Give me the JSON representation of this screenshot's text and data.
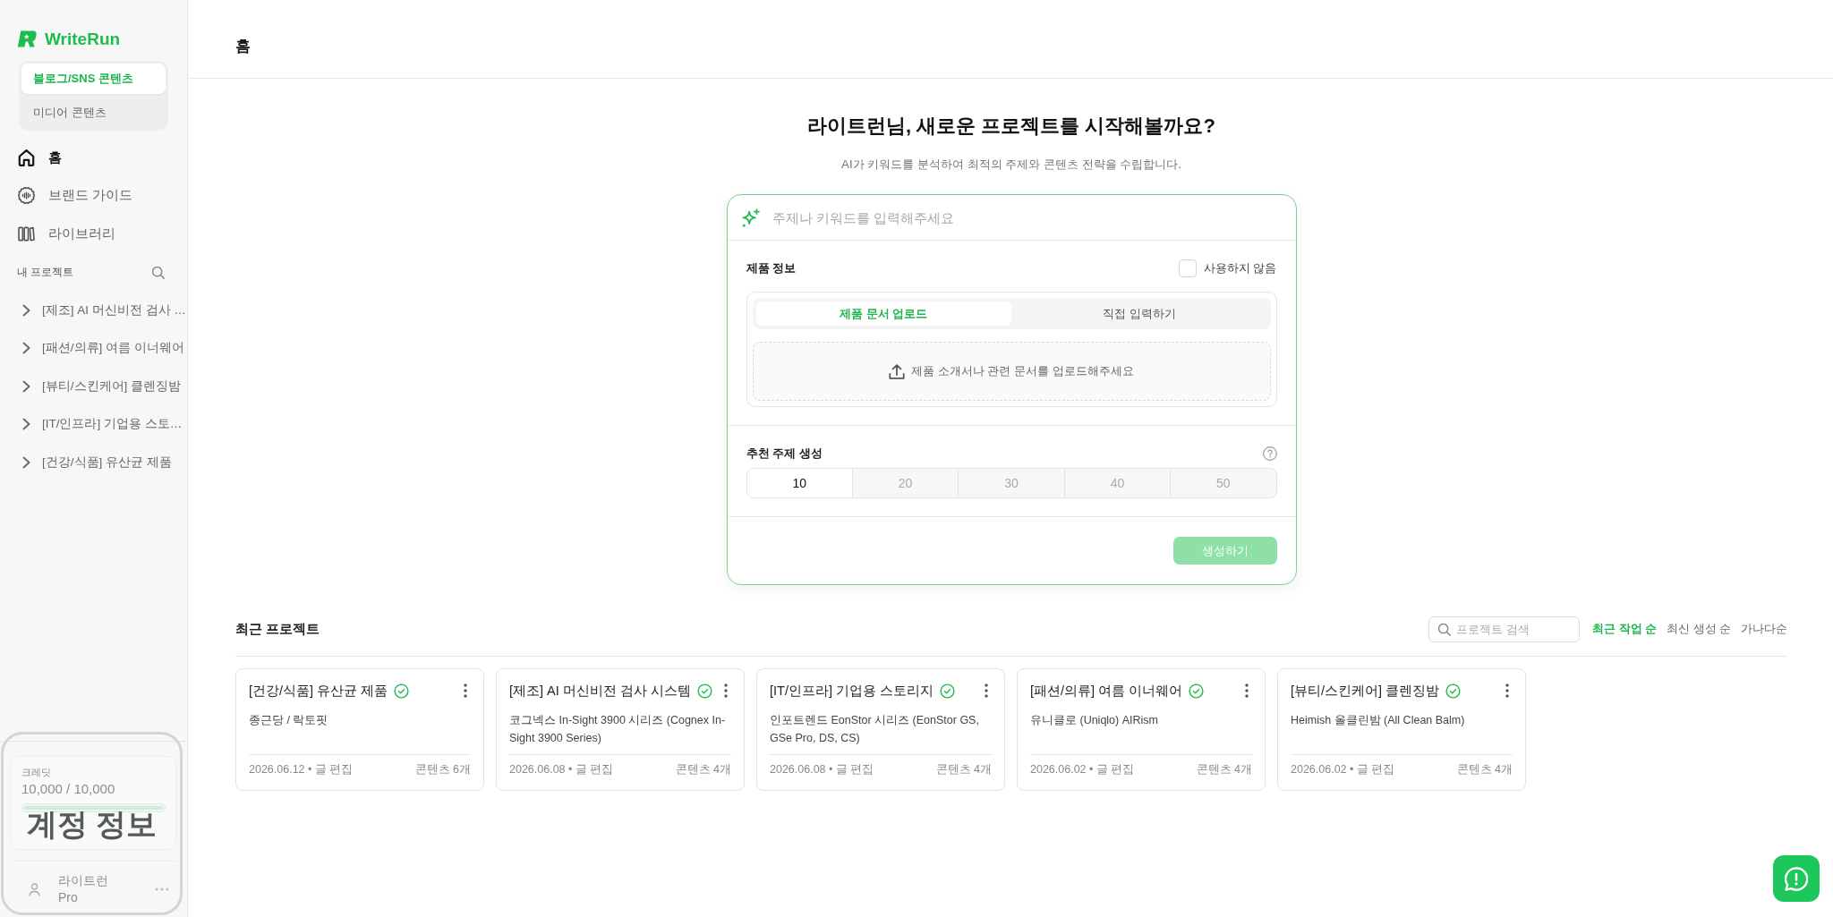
{
  "sidebar": {
    "logo": {
      "text": "WriteRun"
    },
    "content_types": [
      {
        "label": "블로그/SNS 콘텐츠",
        "selected": true
      },
      {
        "label": "미디어 콘텐츠",
        "selected": false
      }
    ],
    "nav": [
      {
        "label": "홈",
        "selected": true
      },
      {
        "label": "브랜드 가이드",
        "selected": false
      },
      {
        "label": "라이브러리",
        "selected": false
      }
    ],
    "projects_heading": "내 프로젝트",
    "projects": [
      {
        "label": "[제조] AI 머신비전 검사 …",
        "expanded": false
      },
      {
        "label": "[패션/의류] 여름 이너웨어",
        "expanded": false
      },
      {
        "label": "[뷰티/스킨케어] 클렌징밤",
        "expanded": false
      },
      {
        "label": "[IT/인프라] 기업용 스토…",
        "expanded": false
      },
      {
        "label": "[건강/식품] 유산균 제품",
        "expanded": false
      }
    ],
    "account": {
      "overlay_label": "계정 정보",
      "credit_label": "크레딧",
      "credit_value": "10,000 / 10,000",
      "credit": {
        "level": 1
      },
      "user_name": "라이트런",
      "plan": "Pro"
    }
  },
  "header": {
    "title": "홈"
  },
  "hero": {
    "title": "라이트런님, 새로운 프로젝트를 시작해볼까요?",
    "subtitle": "AI가 키워드를 분석하여 최적의 주제와 콘텐츠 전략을 수립합니다."
  },
  "form": {
    "keyword_field": {
      "placeholder": "주제나 키워드를 입력해주세요"
    },
    "product_info": {
      "label": "제품 정보",
      "skip_option": {
        "label": "사용하지 않음",
        "checked": false
      },
      "tabs": [
        {
          "label": "제품 문서 업로드",
          "selected": true
        },
        {
          "label": "직접 입력하기",
          "selected": false
        }
      ],
      "upload_hint": "제품 소개서나 관련 문서를 업로드해주세요"
    },
    "topic_count": {
      "label": "추천 주제 생성",
      "options": [
        {
          "label": "10",
          "selected": true
        },
        {
          "label": "20",
          "selected": false
        },
        {
          "label": "30",
          "selected": false
        },
        {
          "label": "40",
          "selected": false
        },
        {
          "label": "50",
          "selected": false
        }
      ]
    },
    "submit": {
      "label": "생성하기",
      "disabled": true
    }
  },
  "recent": {
    "title": "최근 프로젝트",
    "search": {
      "placeholder": "프로젝트 검색"
    },
    "sort_options": [
      {
        "label": "최근 작업 순",
        "selected": true
      },
      {
        "label": "최신 생성 순",
        "selected": false
      },
      {
        "label": "가나다순",
        "selected": false
      }
    ],
    "cards": [
      {
        "title": "[건강/식품] 유산균 제품",
        "completed": true,
        "subtitle": "종근당 / 락토핏",
        "meta": "2026.06.12 • 글 편집",
        "count": "콘텐츠 6개"
      },
      {
        "title": "[제조] AI 머신비전 검사 시스템",
        "completed": true,
        "subtitle": "코그넥스 In-Sight 3900 시리즈 (Cognex In-Sight 3900 Series)",
        "meta": "2026.06.08 • 글 편집",
        "count": "콘텐츠 4개"
      },
      {
        "title": "[IT/인프라] 기업용 스토리지",
        "completed": true,
        "subtitle": "인포트렌드 EonStor 시리즈 (EonStor GS, GSe Pro, DS, CS)",
        "meta": "2026.06.08 • 글 편집",
        "count": "콘텐츠 4개"
      },
      {
        "title": "[패션/의류] 여름 이너웨어",
        "completed": true,
        "subtitle": "유니클로 (Uniqlo) AIRism",
        "meta": "2026.06.02 • 글 편집",
        "count": "콘텐츠 4개"
      },
      {
        "title": "[뷰티/스킨케어] 클렌징밤",
        "completed": true,
        "subtitle": "Heimish 올클린밤 (All Clean Balm)",
        "meta": "2026.06.02 • 글 편집",
        "count": "콘텐츠 4개"
      }
    ]
  }
}
